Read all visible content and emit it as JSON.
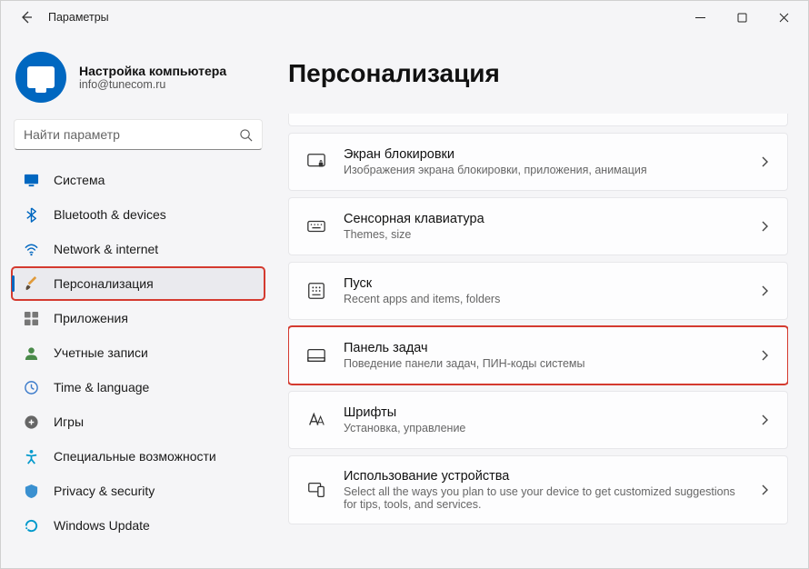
{
  "window": {
    "title": "Параметры"
  },
  "account": {
    "name": "Настройка компьютера",
    "email": "info@tunecom.ru"
  },
  "search": {
    "placeholder": "Найти параметр"
  },
  "nav": [
    {
      "id": "system",
      "label": "Система"
    },
    {
      "id": "bluetooth",
      "label": "Bluetooth & devices"
    },
    {
      "id": "network",
      "label": "Network & internet"
    },
    {
      "id": "personalization",
      "label": "Персонализация",
      "selected": true,
      "highlight": true
    },
    {
      "id": "apps",
      "label": "Приложения"
    },
    {
      "id": "accounts",
      "label": "Учетные записи"
    },
    {
      "id": "time",
      "label": "Time & language"
    },
    {
      "id": "gaming",
      "label": "Игры"
    },
    {
      "id": "accessibility",
      "label": "Специальные возможности"
    },
    {
      "id": "privacy",
      "label": "Privacy & security"
    },
    {
      "id": "update",
      "label": "Windows Update"
    }
  ],
  "page": {
    "title": "Персонализация"
  },
  "cards": [
    {
      "id": "lockscreen",
      "title": "Экран блокировки",
      "subtitle": "Изображения экрана блокировки, приложения, анимация"
    },
    {
      "id": "touchkeyboard",
      "title": "Сенсорная клавиатура",
      "subtitle": "Themes, size"
    },
    {
      "id": "start",
      "title": "Пуск",
      "subtitle": "Recent apps and items, folders"
    },
    {
      "id": "taskbar",
      "title": "Панель задач",
      "subtitle": "Поведение панели задач, ПИН-коды системы",
      "highlight": true
    },
    {
      "id": "fonts",
      "title": "Шрифты",
      "subtitle": "Установка, управление"
    },
    {
      "id": "deviceusage",
      "title": "Использование устройства",
      "subtitle": "Select all the ways you plan to use your device to get customized suggestions for tips, tools, and services."
    }
  ]
}
